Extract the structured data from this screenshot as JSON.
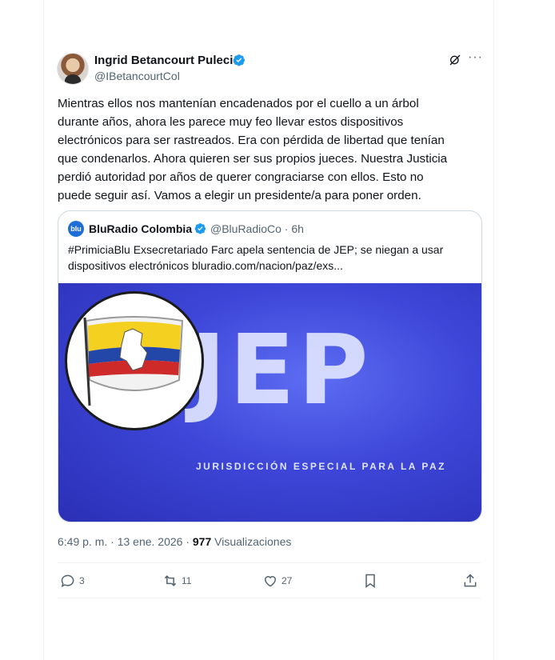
{
  "author": {
    "name": "Ingrid Betancourt Pulecio",
    "handle": "@IBetancourtCol"
  },
  "tweet": {
    "text": "Mientras ellos nos mantenían encadenados por el cuello a un árbol\ndurante años, ahora les parece muy feo llevar estos dispositivos\nelectrónicos para ser rastreados. Era con pérdida de libertad que tenían\nque condenarlos. Ahora quieren ser sus propios jueces. Nuestra Justicia\nperdió autoridad por años de querer congraciarse con ellos. Esto no\npuede seguir así. Vamos a elegir un presidente/a para poner orden.",
    "time": "6:49 p. m. · 13 ene. 2026 · ",
    "views_count": "977",
    "views_label": " Visualizaciones"
  },
  "quote": {
    "logo_text": "blu",
    "name": "BluRadio Colombia",
    "handle_time": "@BluRadioCo · 6h",
    "text": "#PrimiciaBlu Exsecretariado Farc apela sentencia de JEP; se niegan a usar dispositivos electrónicos bluradio.com/nacion/paz/exs...",
    "image_title": "JEP",
    "image_subtitle": "JURISDICCIÓN ESPECIAL PARA LA PAZ"
  },
  "actions": {
    "replies": "3",
    "reposts": "11",
    "likes": "27"
  },
  "colors": {
    "verified": "#1d9bf0",
    "secondary_text": "#536471",
    "jep_blue": "#3d46d8"
  },
  "icons": [
    "verified-badge-icon",
    "grok-icon",
    "more-icon",
    "reply-icon",
    "repost-icon",
    "like-icon",
    "bookmark-icon",
    "share-icon"
  ]
}
